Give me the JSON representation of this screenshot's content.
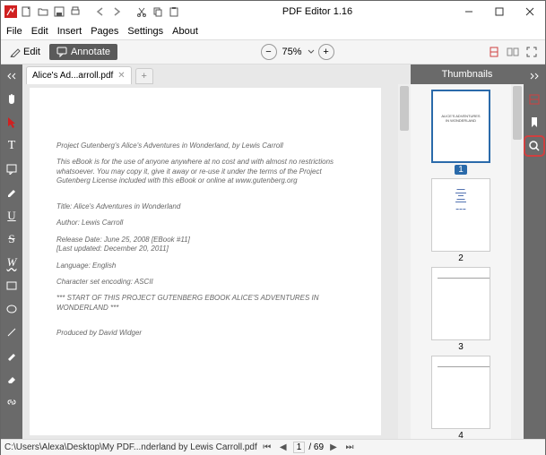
{
  "app": {
    "title": "PDF Editor 1.16"
  },
  "menu": [
    "File",
    "Edit",
    "Insert",
    "Pages",
    "Settings",
    "About"
  ],
  "toolbar": {
    "edit": "Edit",
    "annotate": "Annotate",
    "zoom": "75%"
  },
  "tab": {
    "label": "Alice's Ad...arroll.pdf"
  },
  "document": {
    "p1": "Project Gutenberg's Alice's Adventures in Wonderland, by Lewis Carroll",
    "p2": "This eBook is for the use of anyone anywhere at no cost and with almost no restrictions whatsoever.  You may copy it, give it away or re-use it under the terms of the Project Gutenberg License included with this eBook or online at www.gutenberg.org",
    "p3": "Title: Alice's Adventures in Wonderland",
    "p4": "Author: Lewis Carroll",
    "p5": "Release Date: June 25, 2008 [EBook #11]",
    "p6": "[Last updated: December 20, 2011]",
    "p7": "Language: English",
    "p8": "Character set encoding: ASCII",
    "p9": "*** START OF THIS PROJECT GUTENBERG EBOOK ALICE'S ADVENTURES IN WONDERLAND ***",
    "p10": "Produced by David Widger"
  },
  "thumbnails": {
    "title": "Thumbnails",
    "n1": "1",
    "n2": "2",
    "n3": "3",
    "n4": "4"
  },
  "status": {
    "path": "C:\\Users\\Alexa\\Desktop\\My PDF...nderland by Lewis Carroll.pdf",
    "page": "1",
    "total": "/ 69"
  }
}
